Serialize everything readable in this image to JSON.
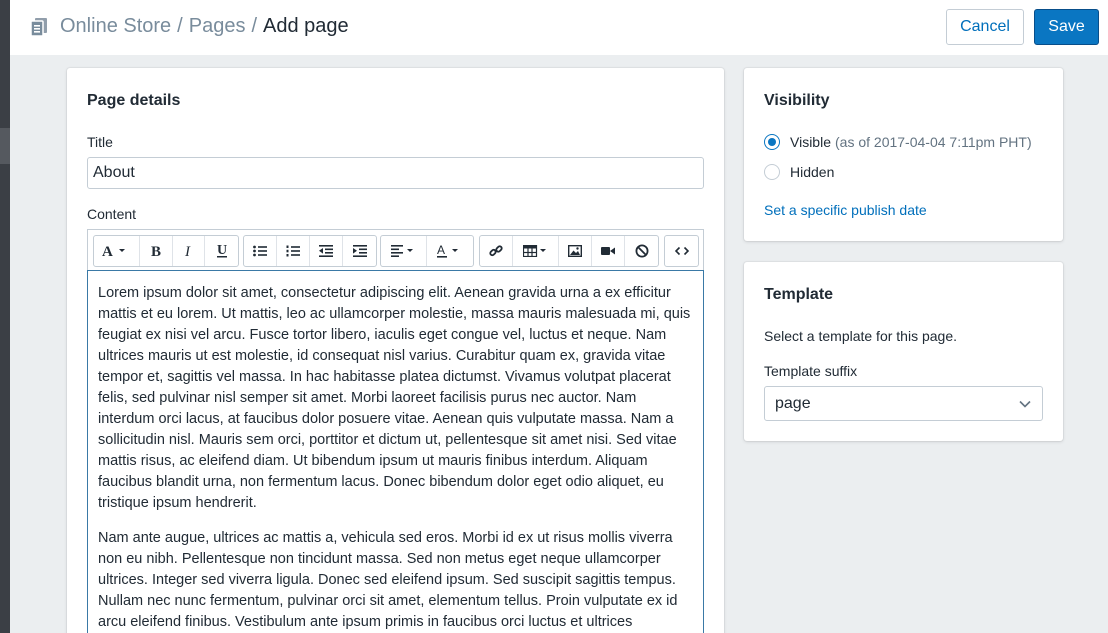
{
  "header": {
    "breadcrumb": [
      "Online Store",
      "Pages"
    ],
    "separator": "/",
    "current": "Add page",
    "cancel_label": "Cancel",
    "save_label": "Save"
  },
  "page_details": {
    "heading": "Page details",
    "title_label": "Title",
    "title_value": "About",
    "content_label": "Content",
    "toolbar_icons": [
      "font-icon",
      "bold-icon",
      "italic-icon",
      "underline-icon",
      "bullet-list-icon",
      "numbered-list-icon",
      "outdent-icon",
      "indent-icon",
      "align-icon",
      "text-color-icon",
      "link-icon",
      "table-icon",
      "image-icon",
      "video-icon",
      "clear-format-icon",
      "html-icon"
    ],
    "paragraphs": [
      "Lorem ipsum dolor sit amet, consectetur adipiscing elit. Aenean gravida urna a ex efficitur mattis et eu lorem. Ut mattis, leo ac ullamcorper molestie, massa mauris malesuada mi, quis feugiat ex nisi vel arcu. Fusce tortor libero, iaculis eget congue vel, luctus et neque. Nam ultrices mauris ut est molestie, id consequat nisl varius. Curabitur quam ex, gravida vitae tempor et, sagittis vel massa. In hac habitasse platea dictumst. Vivamus volutpat placerat felis, sed pulvinar nisl semper sit amet. Morbi laoreet facilisis purus nec auctor. Nam interdum orci lacus, at faucibus dolor posuere vitae. Aenean quis vulputate massa. Nam a sollicitudin nisl. Mauris sem orci, porttitor et dictum ut, pellentesque sit amet nisi. Sed vitae mattis risus, ac eleifend diam. Ut bibendum ipsum ut mauris finibus interdum. Aliquam faucibus blandit urna, non fermentum lacus. Donec bibendum dolor eget odio aliquet, eu tristique ipsum hendrerit.",
      "Nam ante augue, ultrices ac mattis a, vehicula sed eros. Morbi id ex ut risus mollis viverra non eu nibh. Pellentesque non tincidunt massa. Sed non metus eget neque ullamcorper ultrices. Integer sed viverra ligula. Donec sed eleifend ipsum. Sed suscipit sagittis tempus. Nullam nec nunc fermentum, pulvinar orci sit amet, elementum tellus. Proin vulputate ex id arcu eleifend finibus. Vestibulum ante ipsum primis in faucibus orci luctus et ultrices"
    ]
  },
  "visibility": {
    "heading": "Visibility",
    "visible_label": "Visible",
    "visible_note": "(as of 2017-04-04 7:11pm PHT)",
    "hidden_label": "Hidden",
    "selected": "Visible",
    "publish_link": "Set a specific publish date"
  },
  "template": {
    "heading": "Template",
    "description": "Select a template for this page.",
    "suffix_label": "Template suffix",
    "suffix_value": "page"
  },
  "colors": {
    "accent": "#0a76c2",
    "link": "#006fbb",
    "background": "#ebeef0"
  }
}
